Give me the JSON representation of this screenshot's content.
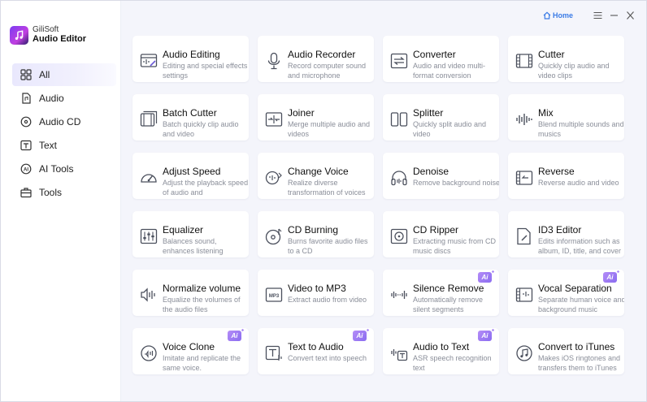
{
  "app": {
    "brand": "GiliSoft",
    "name": "Audio Editor"
  },
  "topbar": {
    "home_label": "Home"
  },
  "sidebar": {
    "items": [
      {
        "label": "All",
        "icon": "grid-icon",
        "active": true
      },
      {
        "label": "Audio",
        "icon": "audio-file-icon",
        "active": false
      },
      {
        "label": "Audio CD",
        "icon": "cd-icon",
        "active": false
      },
      {
        "label": "Text",
        "icon": "text-icon",
        "active": false
      },
      {
        "label": "AI Tools",
        "icon": "ai-icon",
        "active": false
      },
      {
        "label": "Tools",
        "icon": "toolbox-icon",
        "active": false
      }
    ]
  },
  "tools": [
    {
      "title": "Audio Editing",
      "desc": "Editing and special effects settings",
      "icon": "audio-editing-icon",
      "ai": false
    },
    {
      "title": "Audio Recorder",
      "desc": "Record computer sound and microphone",
      "icon": "microphone-icon",
      "ai": false
    },
    {
      "title": "Converter",
      "desc": "Audio and video multi-format conversion",
      "icon": "converter-icon",
      "ai": false
    },
    {
      "title": "Cutter",
      "desc": "Quickly clip audio and video clips",
      "icon": "film-cut-icon",
      "ai": false
    },
    {
      "title": "Batch Cutter",
      "desc": "Batch quickly clip audio and video",
      "icon": "batch-film-icon",
      "ai": false
    },
    {
      "title": "Joiner",
      "desc": "Merge multiple audio and videos",
      "icon": "joiner-icon",
      "ai": false
    },
    {
      "title": "Splitter",
      "desc": "Quickly split audio and video",
      "icon": "splitter-icon",
      "ai": false
    },
    {
      "title": "Mix",
      "desc": "Blend multiple sounds and musics",
      "icon": "mix-icon",
      "ai": false
    },
    {
      "title": "Adjust Speed",
      "desc": "Adjust the playback speed of audio and",
      "icon": "speedometer-icon",
      "ai": false
    },
    {
      "title": "Change Voice",
      "desc": "Realize diverse transformation of voices",
      "icon": "voice-change-icon",
      "ai": false
    },
    {
      "title": "Denoise",
      "desc": "Remove background noise",
      "icon": "headphones-icon",
      "ai": false
    },
    {
      "title": "Reverse",
      "desc": "Reverse audio and video",
      "icon": "reverse-icon",
      "ai": false
    },
    {
      "title": "Equalizer",
      "desc": "Balances sound, enhances listening",
      "icon": "equalizer-icon",
      "ai": false
    },
    {
      "title": "CD Burning",
      "desc": "Burns favorite audio files to a CD",
      "icon": "cd-burn-icon",
      "ai": false
    },
    {
      "title": "CD Ripper",
      "desc": "Extracting music from CD music discs",
      "icon": "cd-ripper-icon",
      "ai": false
    },
    {
      "title": "ID3 Editor",
      "desc": "Edits information such as album, ID, title, and cover",
      "icon": "id3-edit-icon",
      "ai": false
    },
    {
      "title": "Normalize volume",
      "desc": "Equalize the volumes of the audio files",
      "icon": "normalize-icon",
      "ai": false
    },
    {
      "title": "Video to MP3",
      "desc": "Extract audio from video",
      "icon": "mp3-icon",
      "ai": false
    },
    {
      "title": "Silence Remove",
      "desc": "Automatically remove silent segments",
      "icon": "silence-remove-icon",
      "ai": true
    },
    {
      "title": "Vocal Separation",
      "desc": "Separate human voice and background music",
      "icon": "vocal-separation-icon",
      "ai": true
    },
    {
      "title": "Voice Clone",
      "desc": "Imitate and replicate the same voice.",
      "icon": "voice-clone-icon",
      "ai": true
    },
    {
      "title": "Text to Audio",
      "desc": "Convert text into speech",
      "icon": "text-to-audio-icon",
      "ai": true
    },
    {
      "title": "Audio to Text",
      "desc": "ASR speech recognition text",
      "icon": "audio-to-text-icon",
      "ai": true
    },
    {
      "title": "Convert to iTunes",
      "desc": "Makes iOS ringtones and transfers them to iTunes",
      "icon": "itunes-icon",
      "ai": false
    }
  ],
  "ai_badge_label": "Ai",
  "colors": {
    "accent": "#3a7be6",
    "active_nav": "#e9e8fd",
    "ai_badge": "#9f7cf3",
    "icon_stroke": "#4a4f5c"
  }
}
